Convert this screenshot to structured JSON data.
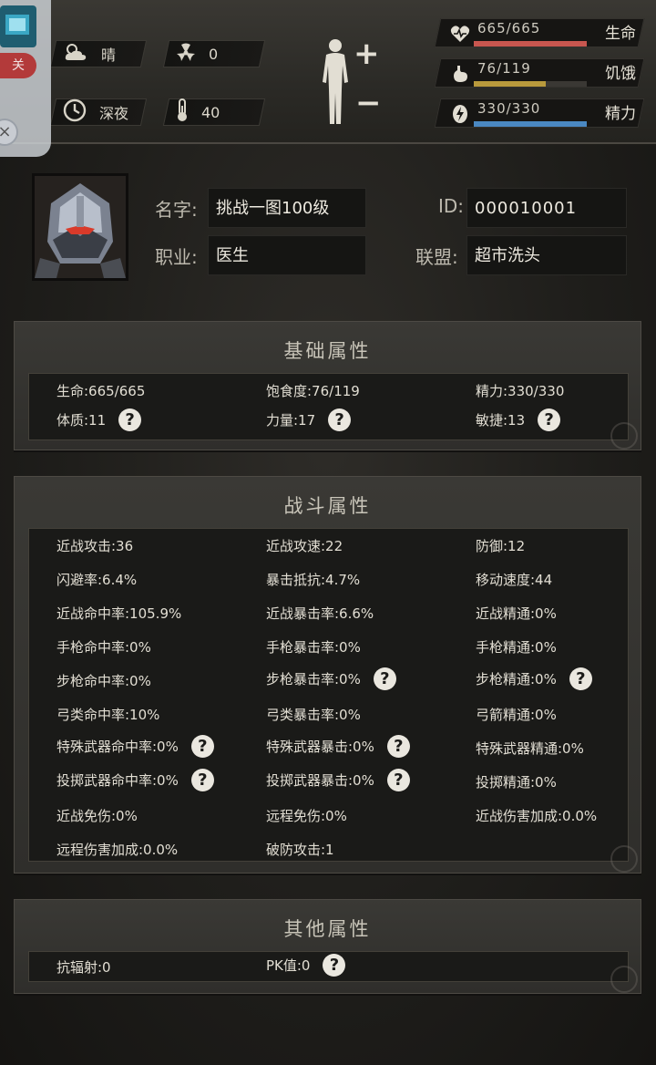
{
  "topbar": {
    "weather": "晴",
    "radiation": "0",
    "time_of_day": "深夜",
    "temperature": "40",
    "body_plus": "+",
    "body_minus": "−",
    "vitals": [
      {
        "label": "生命",
        "value": "665/665",
        "fraction": 1.0,
        "color": "#c8564f",
        "icon": "heart-icon"
      },
      {
        "label": "饥饿",
        "value": "76/119",
        "fraction": 0.64,
        "color": "#b99a3c",
        "icon": "stomach-icon"
      },
      {
        "label": "精力",
        "value": "330/330",
        "fraction": 1.0,
        "color": "#4a88c2",
        "icon": "energy-icon"
      }
    ]
  },
  "overlay": {
    "close_label": "关"
  },
  "profile": {
    "name_label": "名字:",
    "name_value": "挑战一图100级",
    "job_label": "职业:",
    "job_value": "医生",
    "id_label": "ID:",
    "id_value": "000010001",
    "alliance_label": "联盟:",
    "alliance_value": "超市洗头"
  },
  "basic": {
    "title": "基础属性",
    "rows": [
      [
        "生命:665/665",
        "饱食度:76/119",
        "精力:330/330"
      ],
      [
        "体质:11",
        "力量:17",
        "敏捷:13"
      ]
    ]
  },
  "combat": {
    "title": "战斗属性",
    "rows": [
      [
        "近战攻击:36",
        "近战攻速:22",
        "防御:12"
      ],
      [
        "闪避率:6.4%",
        "暴击抵抗:4.7%",
        "移动速度:44"
      ],
      [
        "近战命中率:105.9%",
        "近战暴击率:6.6%",
        "近战精通:0%"
      ],
      [
        "手枪命中率:0%",
        "手枪暴击率:0%",
        "手枪精通:0%"
      ],
      [
        "步枪命中率:0%",
        "步枪暴击率:0%",
        "步枪精通:0%"
      ],
      [
        "弓类命中率:10%",
        "弓类暴击率:0%",
        "弓箭精通:0%"
      ],
      [
        "特殊武器命中率:0%",
        "特殊武器暴击:0%",
        "特殊武器精通:0%"
      ],
      [
        "投掷武器命中率:0%",
        "投掷武器暴击:0%",
        "投掷精通:0%"
      ],
      [
        "近战免伤:0%",
        "远程免伤:0%",
        "近战伤害加成:0.0%"
      ],
      [
        "远程伤害加成:0.0%",
        "破防攻击:1",
        ""
      ]
    ]
  },
  "other": {
    "title": "其他属性",
    "rows": [
      [
        "抗辐射:0",
        "PK值:0"
      ]
    ]
  },
  "help_glyph": "?"
}
